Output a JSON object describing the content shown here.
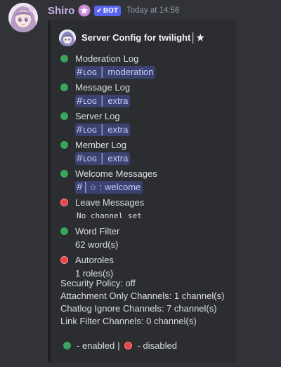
{
  "message": {
    "username": "Shiro",
    "bot_tag": "BOT",
    "timestamp": "Today at 14:56",
    "avatar_icon": "anime-girl-avatar",
    "colors": {
      "username": "#c9b3e6",
      "bot_tag": "#5865f2",
      "enabled": "#3ba55d",
      "disabled": "#ed4245",
      "mention_bg": "#3c4270"
    }
  },
  "embed": {
    "author": "Server Config for twilight│★",
    "entries": [
      {
        "label": "Moderation Log",
        "status": "enabled",
        "value_type": "channel",
        "channel_hash": "#",
        "channel": "ʟᴏɢ │ moderation"
      },
      {
        "label": "Message Log",
        "status": "enabled",
        "value_type": "channel",
        "channel_hash": "#",
        "channel": "ʟᴏɢ │ extra"
      },
      {
        "label": "Server Log",
        "status": "enabled",
        "value_type": "channel",
        "channel_hash": "#",
        "channel": "ʟᴏɢ │ extra"
      },
      {
        "label": "Member Log",
        "status": "enabled",
        "value_type": "channel",
        "channel_hash": "#",
        "channel": "ʟᴏɢ │ extra"
      },
      {
        "label": "Welcome Messages",
        "status": "enabled",
        "value_type": "channel",
        "channel_hash": "#",
        "channel": "│☆ : welcome"
      },
      {
        "label": "Leave Messages",
        "status": "disabled",
        "value_type": "code",
        "value": "No channel set"
      },
      {
        "label": "Word Filter",
        "status": "enabled",
        "value_type": "text",
        "value": "62 word(s)"
      },
      {
        "label": "Autoroles",
        "status": "disabled",
        "value_type": "text",
        "value": "1 roles(s)"
      }
    ],
    "stats": {
      "security_policy": "Security Policy: off",
      "attachment_only": "Attachment Only Channels: 1 channel(s)",
      "chatlog_ignore": "Chatlog Ignore Channels: 7 channel(s)",
      "link_filter": "Link Filter Channels: 0 channel(s)"
    },
    "legend": {
      "enabled": "- enabled",
      "separator": "|",
      "disabled": "- disabled"
    }
  }
}
